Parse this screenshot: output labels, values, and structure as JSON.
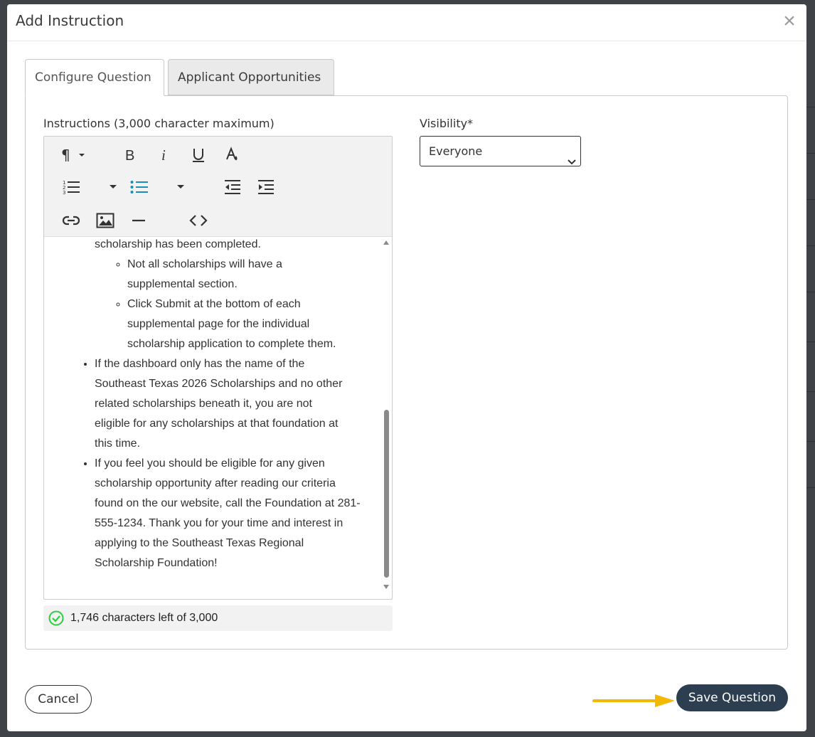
{
  "modal": {
    "title": "Add Instruction",
    "close_glyph": "×"
  },
  "tabs": [
    {
      "label": "Configure Question",
      "active": true
    },
    {
      "label": "Applicant Opportunities",
      "active": false
    }
  ],
  "instructions": {
    "label": "Instructions (3,000 character maximum)",
    "toolbar_icons": [
      "paragraph-icon",
      "bold-icon",
      "italic-icon",
      "underline-icon",
      "text-color-icon",
      "ordered-list-icon",
      "unordered-list-icon",
      "outdent-icon",
      "indent-icon",
      "link-icon",
      "image-icon",
      "horizontal-rule-icon",
      "code-view-icon"
    ],
    "content": {
      "partial_line": "scholarship has been completed.",
      "sub_items": [
        "Not all scholarships will have a supplemental section.",
        "Click Submit at the bottom of each supplemental page for the individual scholarship application to complete them."
      ],
      "items": [
        "If the dashboard only has the name of the Southeast Texas 2026 Scholarships and no other related scholarships beneath it, you are not eligible for any scholarships at that foundation at this time.",
        "If you feel you should be eligible for any given scholarship opportunity after reading our criteria found on the our website, call the Foundation at 281-555-1234. Thank you for your time and interest in applying to the Southeast Texas Regional Scholarship Foundation!"
      ]
    },
    "counter": "1,746 characters left of 3,000"
  },
  "visibility": {
    "label": "Visibility*",
    "selected": "Everyone"
  },
  "footer": {
    "cancel_label": "Cancel",
    "save_label": "Save Question"
  },
  "colors": {
    "save_button": "#2c3e50",
    "annotation_arrow": "#f5b800",
    "counter_ok": "#2ecc40",
    "active_list_icon": "#1a8fb3"
  }
}
